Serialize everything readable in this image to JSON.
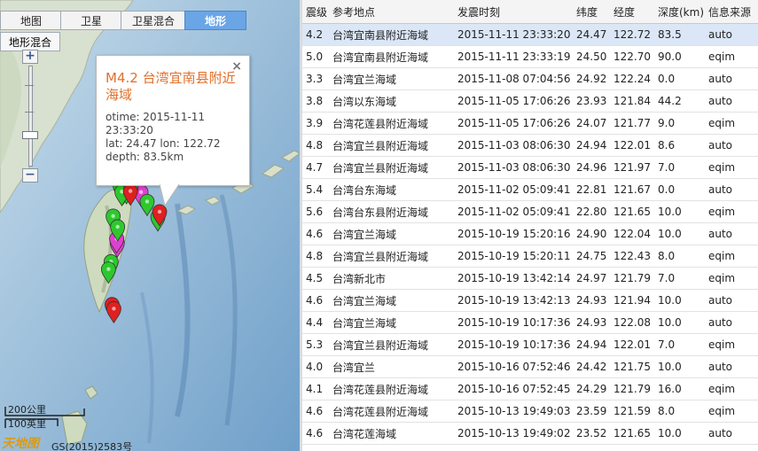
{
  "map": {
    "tabs": [
      "地图",
      "卫星",
      "卫星混合",
      "地形"
    ],
    "active_tab": "地形",
    "sub_tab": "地形混合",
    "zoom_in_label": "+",
    "zoom_out_label": "−",
    "popup": {
      "title": "M4.2 台湾宜南县附近海域",
      "otime": "otime: 2015-11-11 23:33:20",
      "latlon": "lat: 24.47 lon: 122.72",
      "depth": "depth: 83.5km",
      "close": "×"
    },
    "scale_km": "200公里",
    "scale_mi": "100英里",
    "logo": "天地图",
    "copyright": "GS(2015)2583号",
    "marker_colors": {
      "m3": "#e040d0",
      "m4": "#2ec82e",
      "m5": "#e02020"
    }
  },
  "table": {
    "headers": [
      "震级",
      "参考地点",
      "发震时刻",
      "纬度",
      "经度",
      "深度(km)",
      "信息来源"
    ],
    "rows": [
      [
        "4.2",
        "台湾宜南县附近海域",
        "2015-11-11 23:33:20",
        "24.47",
        "122.72",
        "83.5",
        "auto"
      ],
      [
        "5.0",
        "台湾宜南县附近海域",
        "2015-11-11 23:33:19",
        "24.50",
        "122.70",
        "90.0",
        "eqim"
      ],
      [
        "3.3",
        "台湾宜兰海域",
        "2015-11-08 07:04:56",
        "24.92",
        "122.24",
        "0.0",
        "auto"
      ],
      [
        "3.8",
        "台湾以东海域",
        "2015-11-05 17:06:26",
        "23.93",
        "121.84",
        "44.2",
        "auto"
      ],
      [
        "3.9",
        "台湾花莲县附近海域",
        "2015-11-05 17:06:26",
        "24.07",
        "121.77",
        "9.0",
        "eqim"
      ],
      [
        "4.8",
        "台湾宜兰县附近海域",
        "2015-11-03 08:06:30",
        "24.94",
        "122.01",
        "8.6",
        "auto"
      ],
      [
        "4.7",
        "台湾宜兰县附近海域",
        "2015-11-03 08:06:30",
        "24.96",
        "121.97",
        "7.0",
        "eqim"
      ],
      [
        "5.4",
        "台湾台东海域",
        "2015-11-02 05:09:41",
        "22.81",
        "121.67",
        "0.0",
        "auto"
      ],
      [
        "5.6",
        "台湾台东县附近海域",
        "2015-11-02 05:09:41",
        "22.80",
        "121.65",
        "10.0",
        "eqim"
      ],
      [
        "4.6",
        "台湾宜兰海域",
        "2015-10-19 15:20:16",
        "24.90",
        "122.04",
        "10.0",
        "auto"
      ],
      [
        "4.8",
        "台湾宜兰县附近海域",
        "2015-10-19 15:20:11",
        "24.75",
        "122.43",
        "8.0",
        "eqim"
      ],
      [
        "4.5",
        "台湾新北市",
        "2015-10-19 13:42:14",
        "24.97",
        "121.79",
        "7.0",
        "eqim"
      ],
      [
        "4.6",
        "台湾宜兰海域",
        "2015-10-19 13:42:13",
        "24.93",
        "121.94",
        "10.0",
        "auto"
      ],
      [
        "4.4",
        "台湾宜兰海域",
        "2015-10-19 10:17:36",
        "24.93",
        "122.08",
        "10.0",
        "auto"
      ],
      [
        "5.3",
        "台湾宜兰县附近海域",
        "2015-10-19 10:17:36",
        "24.94",
        "122.01",
        "7.0",
        "eqim"
      ],
      [
        "4.0",
        "台湾宜兰",
        "2015-10-16 07:52:46",
        "24.42",
        "121.75",
        "10.0",
        "auto"
      ],
      [
        "4.1",
        "台湾花莲县附近海域",
        "2015-10-16 07:52:45",
        "24.29",
        "121.79",
        "16.0",
        "eqim"
      ],
      [
        "4.6",
        "台湾花莲县附近海域",
        "2015-10-13 19:49:03",
        "23.59",
        "121.59",
        "8.0",
        "eqim"
      ],
      [
        "4.6",
        "台湾花莲海域",
        "2015-10-13 19:49:02",
        "23.52",
        "121.65",
        "10.0",
        "auto"
      ]
    ]
  }
}
